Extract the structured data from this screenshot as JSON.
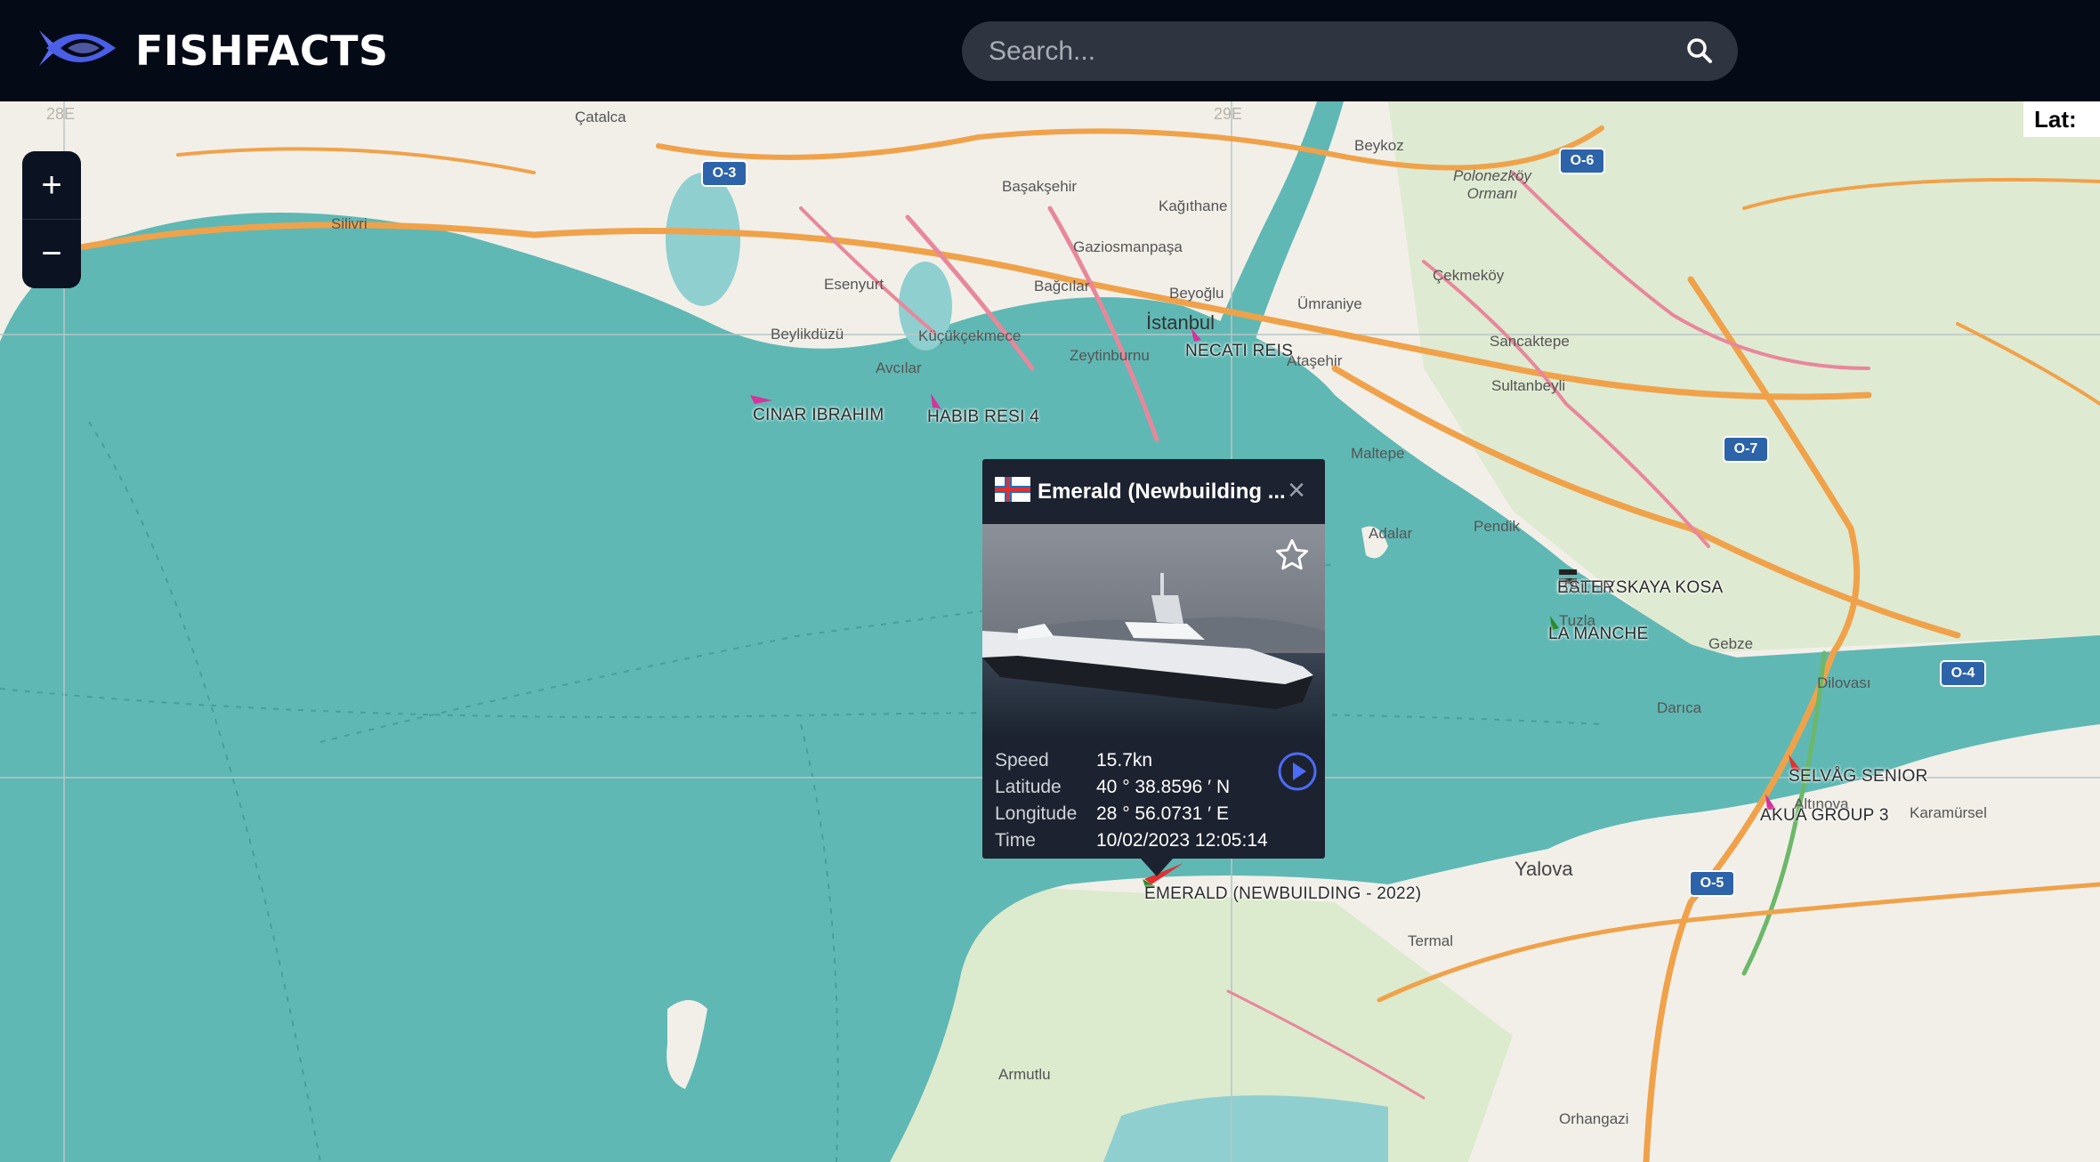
{
  "header": {
    "brand": "FISHFACTS",
    "search_placeholder": "Search..."
  },
  "colors": {
    "topbar": "#050a17",
    "sea": "#5fb8b4",
    "land": "#f2efe9",
    "popup": "#1d2230",
    "accent": "#4a6cf7"
  },
  "map": {
    "zoom_in": "+",
    "zoom_out": "−",
    "coordinate_label": "Lat: ",
    "grid_labels": [
      "28E",
      "29E"
    ],
    "towns": [
      "Çatalca",
      "Silivri",
      "Başakşehir",
      "Kağıthane",
      "Gaziosmanpaşa",
      "Esenyurt",
      "Bağcılar",
      "Beyoğlu",
      "İstanbul",
      "Ümraniye",
      "Çekmeköy",
      "Polonezköy Ormanı",
      "Beylikdüzü",
      "Küçükçekmece",
      "Avcılar",
      "Zeytinburnu",
      "Ataşehir",
      "Sancaktepe",
      "Sultanbeyli",
      "Maltepe",
      "Pendik",
      "Adalar",
      "Tuzla",
      "Gebze",
      "Darıca",
      "Dilovası",
      "Altınova",
      "Karamürsel",
      "Yalova",
      "Termal",
      "Armutlu",
      "Orhangazi",
      "Beykoz"
    ],
    "road_shields": [
      "O-3",
      "O-6",
      "O-7",
      "O-4",
      "O-5"
    ],
    "vessels": [
      {
        "name": "CINAR IBRAHIM",
        "color": "#d6339b"
      },
      {
        "name": "HABIB RESI 4",
        "color": "#d6339b"
      },
      {
        "name": "NECATI REIS",
        "color": "#d6339b"
      },
      {
        "name": "BALTIYSKAYA KOSA",
        "color": "#111111"
      },
      {
        "name": "ESTER",
        "color": "#111111"
      },
      {
        "name": "LA MANCHE",
        "color": "#2a8a2a"
      },
      {
        "name": "SELVÅG SENIOR",
        "color": "#e03030"
      },
      {
        "name": "AKUA GROUP 3",
        "color": "#d6339b"
      },
      {
        "name": "EMERALD (NEWBUILDING - 2022)",
        "color": "#2a8a2a"
      }
    ]
  },
  "popup": {
    "title": "Emerald (Newbuilding ...",
    "close": "×",
    "speed_label": "Speed",
    "speed": "15.7kn",
    "lat_label": "Latitude",
    "lat": "40 ° 38.8596 ′ N",
    "lon_label": "Longitude",
    "lon": "28 ° 56.0731 ′ E",
    "time_label": "Time",
    "time": "10/02/2023 12:05:14"
  }
}
